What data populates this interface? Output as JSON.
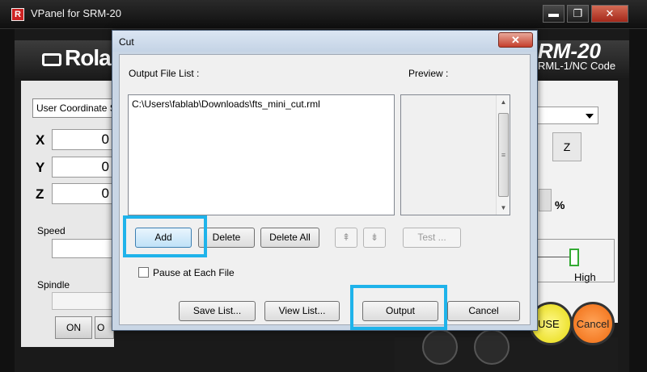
{
  "vpanel": {
    "title": "VPanel for SRM-20",
    "window_controls": {
      "minimize": "▬",
      "maximize": "❐",
      "close": "✕"
    },
    "logo_text": "Rola",
    "model": "RM-20",
    "model_sub": "RML-1/NC Code",
    "coordinate_system": "User Coordinate S",
    "axes": {
      "x": {
        "label": "X",
        "value": "0"
      },
      "y": {
        "label": "Y",
        "value": "0"
      },
      "z": {
        "label": "Z",
        "value": "0"
      }
    },
    "speed_label": "Speed",
    "spindle_label": "Spindle",
    "on_label": "ON",
    "off_label": "O",
    "z_button": "Z",
    "percent": "%",
    "high_label": "High",
    "pause_label": "USE",
    "cancel_label": "Cancel"
  },
  "cut_dialog": {
    "title": "Cut",
    "close_glyph": "✕",
    "output_file_list_label": "Output File List :",
    "preview_label": "Preview :",
    "output_files": [
      "C:\\Users\\fablab\\Downloads\\fts_mini_cut.rml"
    ],
    "buttons": {
      "add": "Add",
      "delete": "Delete",
      "delete_all": "Delete All",
      "move_up": "⇞",
      "move_down": "⇟",
      "test": "Test ...",
      "save_list": "Save List...",
      "view_list": "View List...",
      "output": "Output",
      "cancel": "Cancel"
    },
    "pause_at_each_file_label": "Pause at Each File",
    "pause_at_each_file_checked": false
  },
  "highlight_color": "#1fb3ea"
}
